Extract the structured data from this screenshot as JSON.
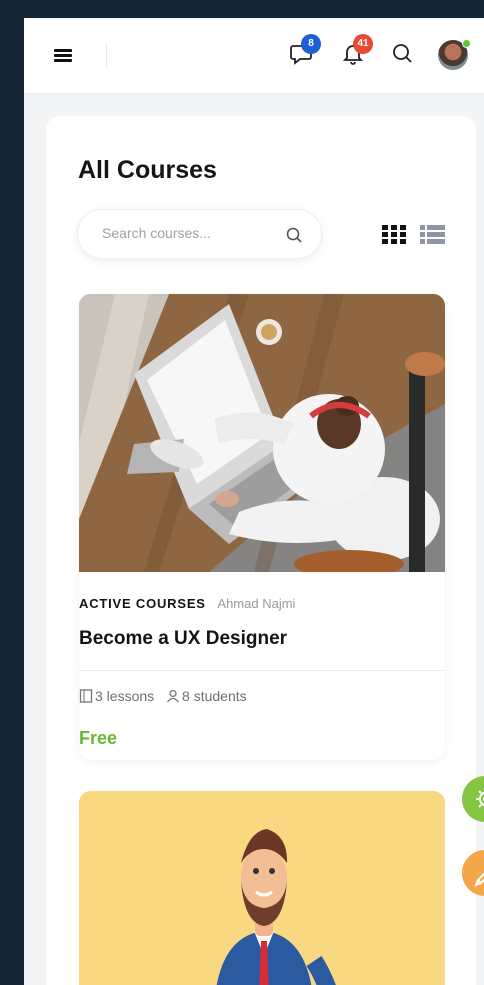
{
  "header": {
    "messages_count": "8",
    "notifications_count": "41",
    "icons": [
      "menu-icon",
      "message-icon",
      "bell-icon",
      "search-icon",
      "user-avatar"
    ]
  },
  "page": {
    "title": "All Courses",
    "search_placeholder": "Search courses..."
  },
  "courses": [
    {
      "category": "ACTIVE COURSES",
      "author": "Ahmad Najmi",
      "title": "Become a UX Designer",
      "lessons": "3 lessons",
      "students": "8 students",
      "price": "Free"
    }
  ],
  "colors": {
    "background": "#172634",
    "price_green": "#69b833",
    "settings_fab": "#86c444",
    "edit_fab": "#f4a64a"
  }
}
